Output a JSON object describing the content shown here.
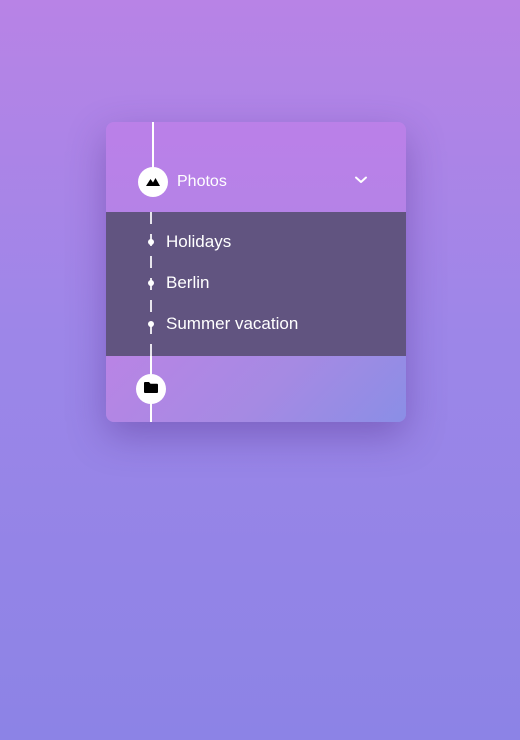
{
  "menu": {
    "header": {
      "icon": "mountain-icon",
      "label": "Photos",
      "toggle_icon": "chevron-down-icon"
    },
    "items": [
      {
        "label": "Holidays"
      },
      {
        "label": "Berlin"
      },
      {
        "label": "Summer vacation"
      }
    ],
    "footer": {
      "icon": "folder-icon"
    }
  },
  "colors": {
    "background_top": "#b883e6",
    "background_bottom": "#8c83e6",
    "header": "#bb80e8",
    "submenu": "#615480",
    "text": "#ffffff"
  }
}
